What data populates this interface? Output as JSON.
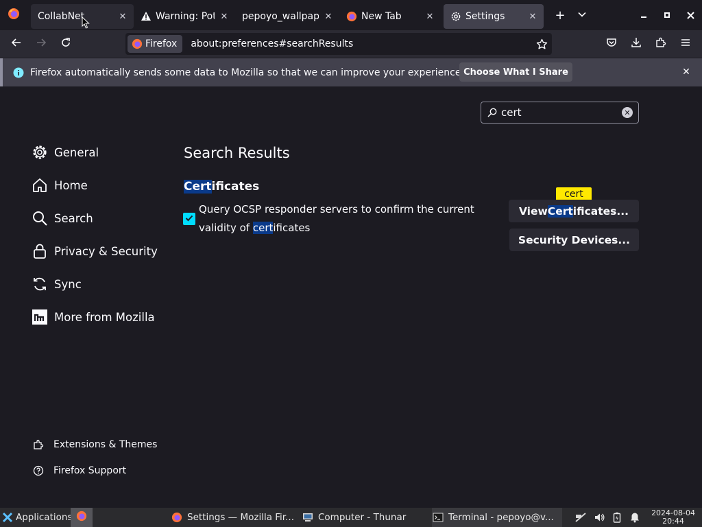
{
  "browser": {
    "tabs": [
      {
        "label": "CollabNet",
        "icon": "firefox-icon"
      },
      {
        "label": "Warning: Pote",
        "icon": "warning-icon"
      },
      {
        "label": "pepoyo_wallpape",
        "icon": ""
      },
      {
        "label": "New Tab",
        "icon": "firefox-icon"
      },
      {
        "label": "Settings",
        "icon": "gear-icon",
        "selected": true
      }
    ],
    "identity_label": "Firefox",
    "url": "about:preferences#searchResults"
  },
  "notification": {
    "message": "Firefox automatically sends some data to Mozilla so that we can improve your experience.",
    "button": "Choose What I Share"
  },
  "settings": {
    "search_value": "cert",
    "nav": [
      {
        "label": "General",
        "icon": "gear-icon"
      },
      {
        "label": "Home",
        "icon": "home-icon"
      },
      {
        "label": "Search",
        "icon": "search-icon"
      },
      {
        "label": "Privacy & Security",
        "icon": "lock-icon"
      },
      {
        "label": "Sync",
        "icon": "sync-icon"
      },
      {
        "label": "More from Mozilla",
        "icon": "mozilla-icon"
      }
    ],
    "footer": [
      {
        "label": "Extensions & Themes",
        "icon": "puzzle-icon"
      },
      {
        "label": "Firefox Support",
        "icon": "help-icon"
      }
    ],
    "results_title": "Search Results",
    "group_title_hl": "Cert",
    "group_title_rest": "ificates",
    "checkbox_checked": true,
    "checkbox_label_1": "Query OCSP responder servers to confirm the current",
    "checkbox_label_2_pre": "validity of ",
    "checkbox_label_2_hl": "cert",
    "checkbox_label_2_post": "ificates",
    "tooltip": "cert",
    "view_cert_pre": "View ",
    "view_cert_hl": "Cert",
    "view_cert_post": "ificates...",
    "security_devices": "Security Devices..."
  },
  "taskbar": {
    "apps_label": "Applications",
    "items": [
      {
        "label": "Settings — Mozilla Fir...",
        "icon": "firefox-icon"
      },
      {
        "label": "Computer - Thunar",
        "icon": "computer-icon"
      },
      {
        "label": "Terminal - pepoyo@v...",
        "icon": "terminal-icon"
      }
    ],
    "date": "2024-08-04",
    "time": "20:44"
  },
  "colors": {
    "accent": "#00ddff",
    "highlight": "#0a3a8a",
    "tooltip": "#ffe900"
  }
}
